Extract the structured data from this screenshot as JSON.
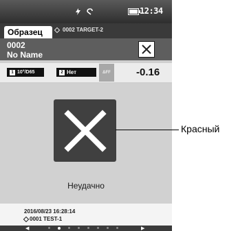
{
  "status_bar": {
    "icons": [
      "lightning-icon",
      "bluetooth-icon",
      "battery-icon"
    ],
    "time": "12:34"
  },
  "tabs": {
    "sample_tab": "Образец",
    "target": "0002 TARGET-2"
  },
  "sample": {
    "number": "0002",
    "name": "No Name"
  },
  "conditions": {
    "chip1_index": "1",
    "chip1_label": "10°/D65",
    "chip2_index": "2",
    "chip2_label": "Нет",
    "delta_label": "ΔFF",
    "value": "-0.16"
  },
  "result": {
    "status": "Неудачно",
    "icon_color": "#404040"
  },
  "footer": {
    "datetime": "2016/08/23 16:28:14",
    "target": "0001 TEST-1"
  },
  "pagination": {
    "page_count": 8,
    "active_index": 1
  },
  "annotation": {
    "label": "Красный"
  }
}
